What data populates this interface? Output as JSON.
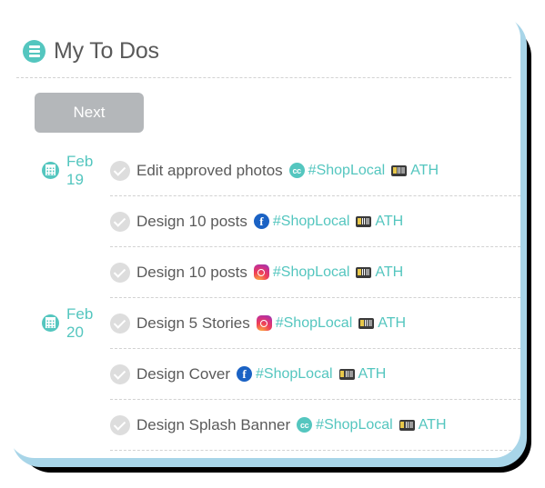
{
  "header": {
    "title": "My To Dos",
    "icon": "list-icon"
  },
  "toolbar": {
    "next_label": "Next"
  },
  "colors": {
    "teal": "#54c6bf",
    "title_gray": "#595959",
    "button_gray": "#b4b7ba",
    "check_gray": "#dddddd",
    "ring_blue": "#a8d5e8"
  },
  "todos": [
    {
      "date": "Feb 19",
      "show_date": true,
      "title": "Edit approved photos",
      "network": "cc",
      "hashtag": "#ShopLocal",
      "client_badge": "client-badge-icon",
      "client": "ATH"
    },
    {
      "date": "",
      "show_date": false,
      "title": "Design 10 posts",
      "network": "facebook",
      "hashtag": "#ShopLocal",
      "client_badge": "client-badge-icon",
      "client": "ATH"
    },
    {
      "date": "",
      "show_date": false,
      "title": "Design 10 posts",
      "network": "instagram",
      "hashtag": "#ShopLocal",
      "client_badge": "client-badge-icon",
      "client": "ATH"
    },
    {
      "date": "Feb 20",
      "show_date": true,
      "title": "Design 5 Stories",
      "network": "instagram",
      "hashtag": "#ShopLocal",
      "client_badge": "client-badge-icon",
      "client": "ATH"
    },
    {
      "date": "",
      "show_date": false,
      "title": "Design Cover",
      "network": "facebook",
      "hashtag": "#ShopLocal",
      "client_badge": "client-badge-icon",
      "client": "ATH"
    },
    {
      "date": "",
      "show_date": false,
      "title": "Design Splash Banner",
      "network": "cc",
      "hashtag": "#ShopLocal",
      "client_badge": "client-badge-icon",
      "client": "ATH"
    }
  ],
  "glyph_labels": {
    "cc": "cc",
    "facebook": "f"
  }
}
